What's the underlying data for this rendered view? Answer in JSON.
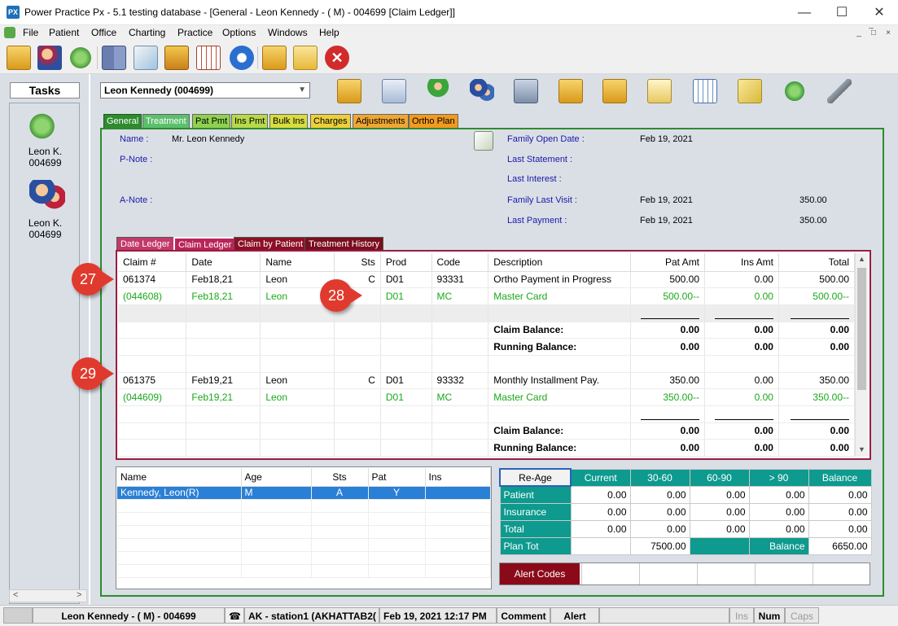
{
  "window": {
    "title": "Power Practice Px - 5.1 testing database - [General - Leon Kennedy - ( M) - 004699 [Claim Ledger]]",
    "app_badge": "PX",
    "minimize": "—",
    "maximize": "☐",
    "close": "✕"
  },
  "menu": [
    "File",
    "Patient",
    "Office",
    "Charting",
    "Practice",
    "Options",
    "Windows",
    "Help"
  ],
  "mdi_controls": [
    "_",
    "̅□",
    "×"
  ],
  "toolbar_icons": [
    "open-folder-icon",
    "patients-icon",
    "refresh-icon",
    "book-icon",
    "chart-icon",
    "gift-box-icon",
    "calendar-icon",
    "info-icon",
    "copy-icon",
    "folder-icon",
    "close-icon"
  ],
  "tasks": {
    "header": "Tasks",
    "items": [
      {
        "line1": "Leon K.",
        "line2": "004699"
      },
      {
        "line1": "Leon K.",
        "line2": "004699"
      }
    ]
  },
  "patient_selector": "Leon Kennedy (004699)",
  "top_tabs": [
    {
      "label": "General",
      "color": "#2e8b2e",
      "active": true
    },
    {
      "label": "Treatment",
      "color": "#5cbf6c"
    },
    {
      "label": "Pat Pmt",
      "color": "#8fd14f"
    },
    {
      "label": "Ins Pmt",
      "color": "#b7d94a"
    },
    {
      "label": "Bulk Ins",
      "color": "#d9dc3f"
    },
    {
      "label": "Charges",
      "color": "#eccf3a"
    },
    {
      "label": "Adjustments",
      "color": "#f0a732"
    },
    {
      "label": "Ortho Plan",
      "color": "#f29a1e"
    }
  ],
  "info": {
    "name_label": "Name :",
    "name_value": "Mr. Leon Kennedy",
    "pnote_label": "P-Note :",
    "anote_label": "A-Note :",
    "family_open_label": "Family Open Date :",
    "family_open_value": "Feb 19, 2021",
    "last_statement_label": "Last Statement :",
    "last_interest_label": "Last Interest :",
    "family_last_visit_label": "Family Last Visit :",
    "family_last_visit_date": "Feb 19, 2021",
    "family_last_visit_amt": "350.00",
    "last_payment_label": "Last Payment :",
    "last_payment_date": "Feb 19, 2021",
    "last_payment_amt": "350.00"
  },
  "sub_tabs": [
    {
      "label": "Date Ledger",
      "color": "#c23a6a"
    },
    {
      "label": "Claim Ledger",
      "color": "#b9255a",
      "active": true
    },
    {
      "label": "Claim by Patient",
      "color": "#8b1026"
    },
    {
      "label": "Treatment History",
      "color": "#7a0d1e"
    }
  ],
  "ledger": {
    "headers": [
      "Claim #",
      "Date",
      "Name",
      "Sts",
      "Prod",
      "Code",
      "Description",
      "Pat Amt",
      "Ins Amt",
      "Total"
    ],
    "rows": [
      {
        "type": "normal",
        "cells": [
          "061374",
          "Feb18,21",
          "Leon",
          "C",
          "D01",
          "93331",
          "Ortho Payment in Progress",
          "500.00",
          "0.00",
          "500.00"
        ]
      },
      {
        "type": "green",
        "cells": [
          "(044608)",
          "Feb18,21",
          "Leon",
          "",
          "D01",
          "MC",
          "Master Card",
          "500.00--",
          "0.00",
          "500.00--"
        ]
      },
      {
        "type": "grey",
        "cells": [
          "",
          "",
          "",
          "",
          "",
          "",
          "",
          "",
          "",
          ""
        ]
      },
      {
        "type": "bold",
        "cells": [
          "",
          "",
          "",
          "",
          "",
          "",
          "Claim Balance:",
          "0.00",
          "0.00",
          "0.00"
        ]
      },
      {
        "type": "bold",
        "cells": [
          "",
          "",
          "",
          "",
          "",
          "",
          "Running Balance:",
          "0.00",
          "0.00",
          "0.00"
        ]
      },
      {
        "type": "normal",
        "cells": [
          "",
          "",
          "",
          "",
          "",
          "",
          "",
          "",
          "",
          ""
        ]
      },
      {
        "type": "normal",
        "cells": [
          "061375",
          "Feb19,21",
          "Leon",
          "C",
          "D01",
          "93332",
          "Monthly Installment Pay.",
          "350.00",
          "0.00",
          "350.00"
        ]
      },
      {
        "type": "green",
        "cells": [
          "(044609)",
          "Feb19,21",
          "Leon",
          "",
          "D01",
          "MC",
          "Master Card",
          "350.00--",
          "0.00",
          "350.00--"
        ]
      },
      {
        "type": "line",
        "cells": [
          "",
          "",
          "",
          "",
          "",
          "",
          "",
          "",
          "",
          ""
        ]
      },
      {
        "type": "bold",
        "cells": [
          "",
          "",
          "",
          "",
          "",
          "",
          "Claim Balance:",
          "0.00",
          "0.00",
          "0.00"
        ]
      },
      {
        "type": "bold",
        "cells": [
          "",
          "",
          "",
          "",
          "",
          "",
          "Running Balance:",
          "0.00",
          "0.00",
          "0.00"
        ]
      }
    ]
  },
  "callouts": [
    "27",
    "28",
    "29"
  ],
  "family": {
    "headers": [
      "Name",
      "Age",
      "Sts",
      "Pat",
      "Ins"
    ],
    "rows": [
      {
        "name": "Kennedy, Leon(R)",
        "age": "M",
        "sts": "A",
        "pat": "Y",
        "ins": ""
      }
    ]
  },
  "aging": {
    "reage_label": "Re-Age",
    "headers": [
      "Current",
      "30-60",
      "60-90",
      "> 90",
      "Balance"
    ],
    "rows": [
      {
        "label": "Patient",
        "values": [
          "0.00",
          "0.00",
          "0.00",
          "0.00",
          "0.00"
        ]
      },
      {
        "label": "Insurance",
        "values": [
          "0.00",
          "0.00",
          "0.00",
          "0.00",
          "0.00"
        ]
      },
      {
        "label": "Total",
        "values": [
          "0.00",
          "0.00",
          "0.00",
          "0.00",
          "0.00"
        ]
      }
    ],
    "plan_tot_label": "Plan Tot",
    "plan_tot_value": "7500.00",
    "balance_label": "Balance",
    "balance_value": "6650.00",
    "alert_codes_label": "Alert Codes"
  },
  "status": {
    "patient": "Leon Kennedy - ( M) - 004699",
    "station": "AK - station1 (AKHATTAB2(",
    "datetime": "Feb 19, 2021 12:17 PM",
    "comment": "Comment",
    "alert": "Alert",
    "ins": "Ins",
    "num": "Num",
    "caps": "Caps"
  }
}
